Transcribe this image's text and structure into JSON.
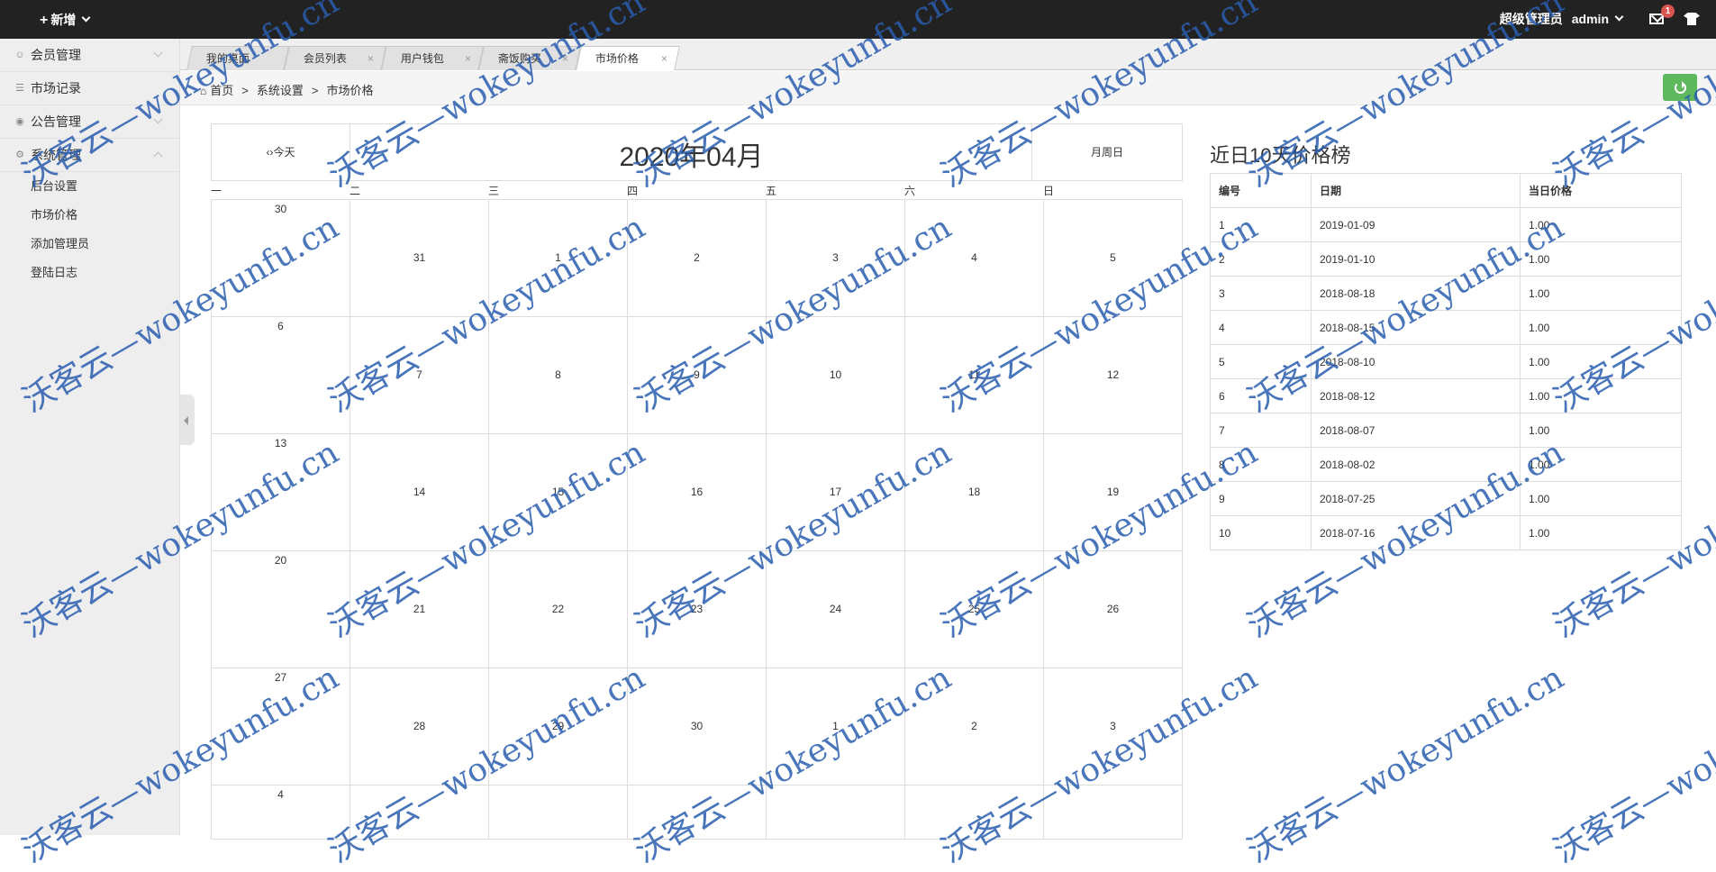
{
  "topbar": {
    "add_label": "新增",
    "role": "超级管理员",
    "user": "admin",
    "mail_count": "1"
  },
  "sidebar": {
    "groups": [
      {
        "label": "会员管理",
        "icon": "user-icon"
      },
      {
        "label": "市场记录",
        "icon": "list-icon"
      },
      {
        "label": "公告管理",
        "icon": "comment-icon"
      },
      {
        "label": "系统管理",
        "icon": "gear-icon"
      }
    ],
    "sub_items": [
      "后台设置",
      "市场价格",
      "添加管理员",
      "登陆日志"
    ]
  },
  "tabs": [
    "我的桌面",
    "会员列表",
    "用户钱包",
    "斋饭购买",
    "市场价格"
  ],
  "breadcrumb": {
    "home": "首页",
    "level1": "系统设置",
    "level2": "市场价格",
    "sep": ">"
  },
  "calendar": {
    "today_label": "‹›今天",
    "title": "2020年04月",
    "views_label": "月周日",
    "weekdays": [
      "一",
      "二",
      "三",
      "四",
      "五",
      "六",
      "日"
    ],
    "weeks": [
      [
        "30",
        "31",
        "1",
        "2",
        "3",
        "4",
        "5"
      ],
      [
        "6",
        "7",
        "8",
        "9",
        "10",
        "11",
        "12"
      ],
      [
        "13",
        "14",
        "15",
        "16",
        "17",
        "18",
        "19"
      ],
      [
        "20",
        "21",
        "22",
        "23",
        "24",
        "25",
        "26"
      ],
      [
        "27",
        "28",
        "29",
        "30",
        "1",
        "2",
        "3"
      ],
      [
        "4",
        "",
        "",
        "",
        "",
        "",
        ""
      ]
    ]
  },
  "ranking": {
    "title": "近日10天价格榜",
    "headers": [
      "编号",
      "日期",
      "当日价格"
    ],
    "rows": [
      [
        "1",
        "2019-01-09",
        "1.00"
      ],
      [
        "2",
        "2019-01-10",
        "1.00"
      ],
      [
        "3",
        "2018-08-18",
        "1.00"
      ],
      [
        "4",
        "2018-08-15",
        "1.00"
      ],
      [
        "5",
        "2018-08-10",
        "1.00"
      ],
      [
        "6",
        "2018-08-12",
        "1.00"
      ],
      [
        "7",
        "2018-08-07",
        "1.00"
      ],
      [
        "8",
        "2018-08-02",
        "1.00"
      ],
      [
        "9",
        "2018-07-25",
        "1.00"
      ],
      [
        "10",
        "2018-07-16",
        "1.00"
      ]
    ]
  },
  "watermark": "沃客云—wokeyunfu.cn"
}
